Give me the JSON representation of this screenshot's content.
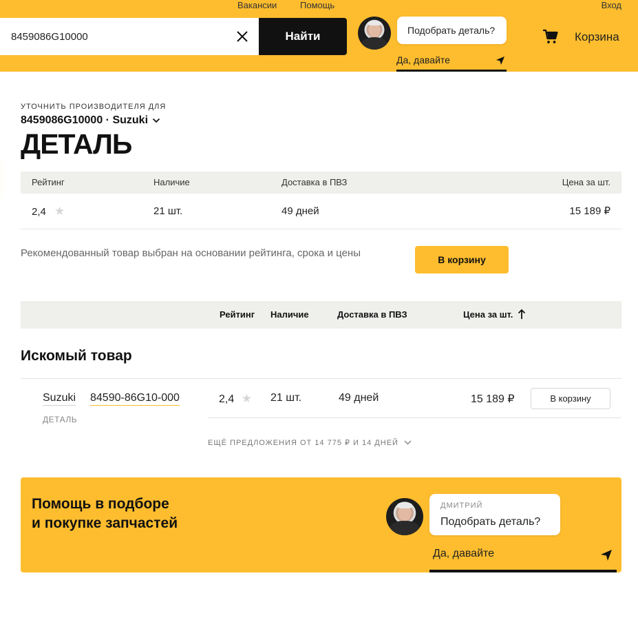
{
  "header": {
    "links": [
      "Вакансии",
      "Помощь"
    ],
    "login": "Вход",
    "search": {
      "value": "8459086G10000",
      "button": "Найти"
    },
    "chat": {
      "question": "Подобрать деталь?",
      "reply": "Да, давайте"
    },
    "cart_label": "Корзина"
  },
  "refine": {
    "label": "УТОЧНИТЬ ПРОИЗВОДИТЕЛЯ ДЛЯ",
    "part": "8459086G10000 · Suzuki",
    "title": "ДЕТАЛЬ"
  },
  "recommended": {
    "headers": {
      "rating": "Рейтинг",
      "stock": "Наличие",
      "delivery": "Доставка в ПВЗ",
      "price": "Цена за шт."
    },
    "row": {
      "rating": "2,4",
      "stock": "21 шт.",
      "delivery": "49 дней",
      "price": "15 189 ₽"
    },
    "note": "Рекомендованный товар выбран на основании рейтинга, срока и цены",
    "cart_button": "В корзину"
  },
  "offers": {
    "headers": {
      "rating": "Рейтинг",
      "stock": "Наличие",
      "delivery": "Доставка в ПВЗ",
      "price": "Цена за шт."
    },
    "section_title": "Искомый товар",
    "item": {
      "brand": "Suzuki",
      "number": "84590-86G10-000",
      "type": "ДЕТАЛЬ",
      "rating": "2,4",
      "stock": "21 шт.",
      "delivery": "49 дней",
      "price": "15 189 ₽",
      "cart_button": "В корзину"
    },
    "more": "ЕЩЁ ПРЕДЛОЖЕНИЯ ОТ 14 775 ₽ И 14 ДНЕЙ"
  },
  "help": {
    "title_line1": "Помощь в подборе",
    "title_line2": "и покупке запчастей",
    "agent_name": "ДМИТРИЙ",
    "question": "Подобрать деталь?",
    "reply": "Да, давайте"
  },
  "colors": {
    "accent": "#fdbd2e",
    "dark": "#111111",
    "table_head": "#efefec"
  },
  "icons": [
    "close-icon",
    "cart-icon",
    "send-icon",
    "chevron-down-icon",
    "star-icon",
    "arrow-up-icon"
  ]
}
